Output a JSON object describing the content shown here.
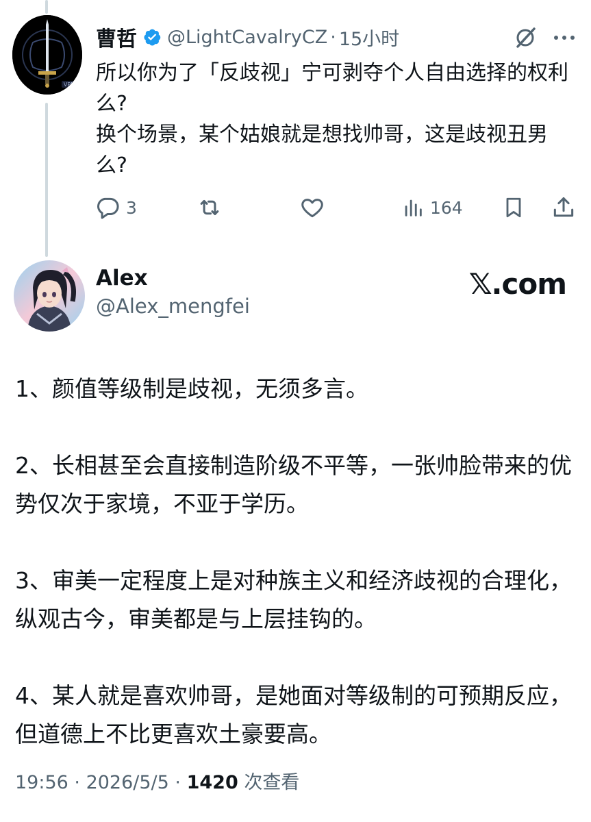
{
  "tweet1": {
    "name": "曹哲",
    "handle": "@LightCavalryCZ",
    "separator": "·",
    "time": "15小时",
    "lines": [
      "所以你为了「反歧视」宁可剥夺个人自由选择的权利么?",
      "换个场景，某个姑娘就是想找帅哥，这是歧视丑男么?"
    ],
    "avatar_badge": "VPN",
    "actions": {
      "replies": "3",
      "views": "164"
    }
  },
  "tweet2": {
    "name": "Alex",
    "handle": "@Alex_mengfei",
    "brand": "𝕏.com",
    "paragraphs": [
      "1、颜值等级制是歧视，无须多言。",
      "2、长相甚至会直接制造阶级不平等，一张帅脸带来的优势仅次于家境，不亚于学历。",
      "3、审美一定程度上是对种族主义和经济歧视的合理化，纵观古今，审美都是与上层挂钩的。",
      "4、某人就是喜欢帅哥，是她面对等级制的可预期反应，但道德上不比更喜欢土豪要高。"
    ],
    "footer": {
      "time": "19:56",
      "sep": " · ",
      "date": "2026/5/5",
      "sep2": " · ",
      "views": "1420",
      "views_label": " 次查看"
    }
  },
  "colors": {
    "accent": "#1d9bf0",
    "text": "#0f1419",
    "muted": "#536471",
    "thread": "#cfd9de"
  },
  "icons": [
    "verified-badge-icon",
    "grok-icon",
    "more-icon",
    "reply-icon",
    "retweet-icon",
    "like-icon",
    "views-icon",
    "bookmark-icon",
    "share-icon"
  ]
}
